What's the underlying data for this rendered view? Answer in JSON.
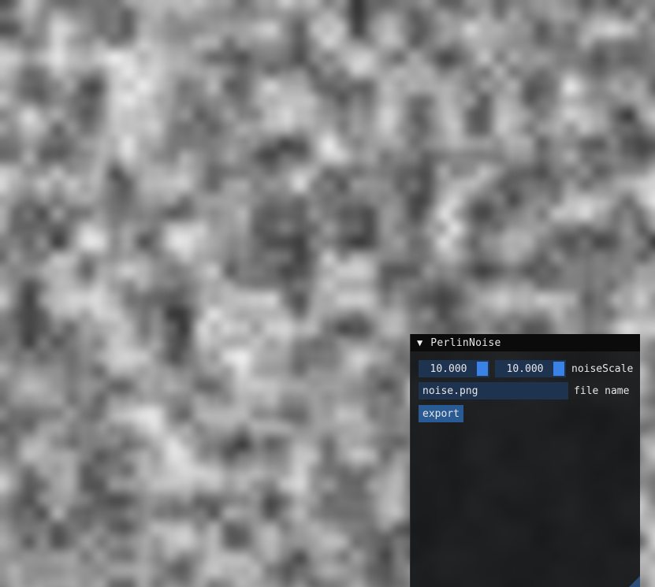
{
  "window": {
    "title": "PerlinNoise",
    "collapse_icon": "▼"
  },
  "noise_scale": {
    "x": "10.000",
    "y": "10.000",
    "label": "noiseScale"
  },
  "file_name": {
    "value": "noise.png",
    "label": "file name"
  },
  "export_button": {
    "label": "export"
  },
  "colors": {
    "panel_bg": "#15171a",
    "field_bg": "#1d3350",
    "grab": "#3b82e6",
    "button": "#295a94",
    "title_bg": "#0b0b0c"
  }
}
